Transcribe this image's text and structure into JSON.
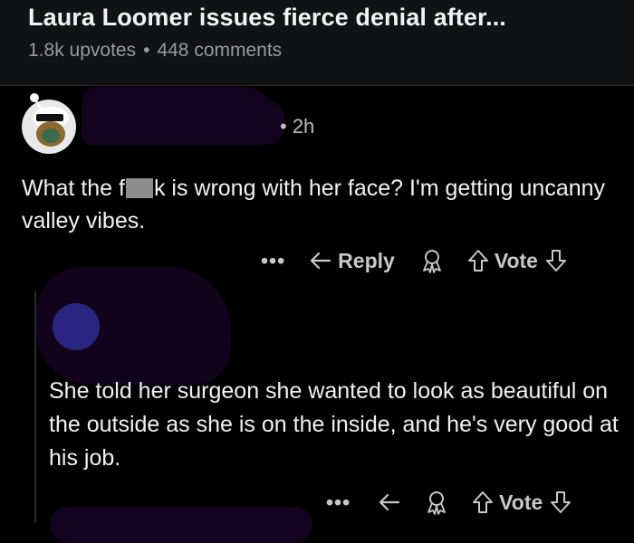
{
  "post": {
    "title": "Laura Loomer issues fierce denial after...",
    "upvotes": "1.8k upvotes",
    "comments": "448 comments",
    "separator": "•"
  },
  "comment1": {
    "time": "• 2h",
    "text_before": "What the f",
    "text_after": "k is wrong with her face? I'm getting uncanny valley vibes.",
    "actions": {
      "more": "•••",
      "reply_label": "Reply",
      "vote_label": "Vote"
    }
  },
  "comment2": {
    "text": "She told her surgeon she wanted to look as beautiful on the outside as she is on the inside, and he's very good at his job.",
    "actions": {
      "more": "•••",
      "vote_label": "Vote"
    }
  },
  "colors": {
    "background": "#000000",
    "header_bg": "#111214",
    "redaction": "#13031f",
    "avatar_nested": "#2a2580"
  },
  "icons": [
    "snoo-avatar-icon",
    "reply-arrow-icon",
    "award-icon",
    "upvote-arrow-icon",
    "downvote-arrow-icon",
    "more-dots-icon"
  ]
}
